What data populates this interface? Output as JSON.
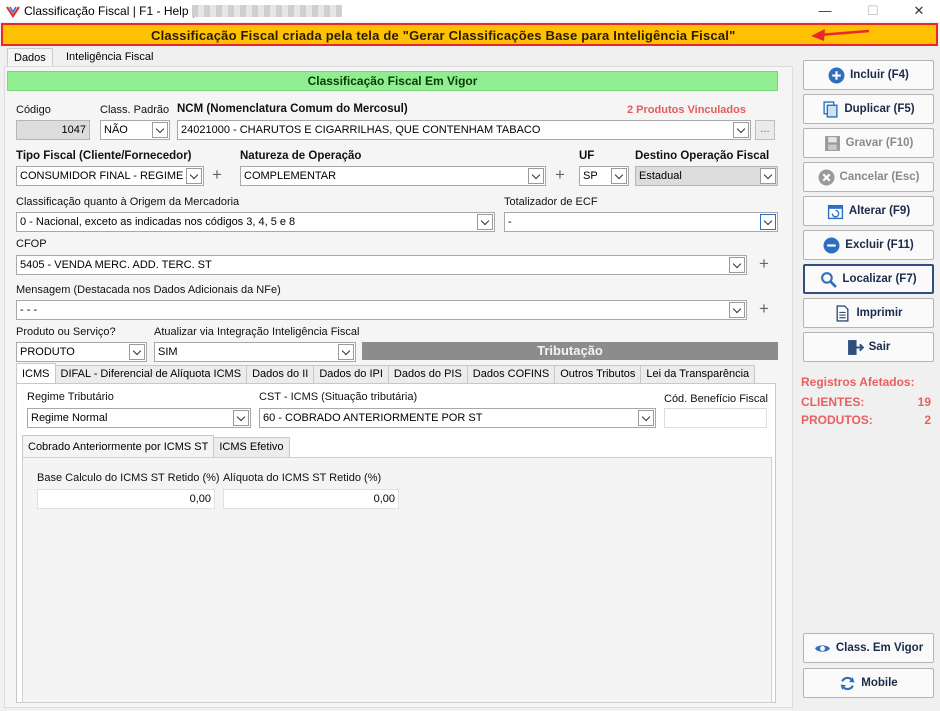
{
  "window": {
    "title": "Classificação Fiscal | F1 - Help |",
    "minimize": "—",
    "maximize": "☐",
    "close": "✕"
  },
  "banner": {
    "text": "Classificação Fiscal criada pela tela de \"Gerar Classificações Base para Inteligência Fiscal\""
  },
  "tabs": [
    "Dados",
    "Inteligência Fiscal"
  ],
  "section": {
    "title": "Classificação Fiscal Em Vigor"
  },
  "fields": {
    "codigo": {
      "label": "Código",
      "value": "1047"
    },
    "class_padrao": {
      "label": "Class. Padrão",
      "value": "NÃO"
    },
    "ncm": {
      "label": "NCM (Nomenclatura Comum do Mercosul)",
      "value": "24021000 - CHARUTOS E CIGARRILHAS, QUE CONTENHAM TABACO",
      "linked": "2 Produtos Vinculados",
      "ellipsis": "..."
    },
    "tipo_fiscal": {
      "label": "Tipo Fiscal (Cliente/Fornecedor)",
      "value": "CONSUMIDOR FINAL - REGIME N"
    },
    "natureza": {
      "label": "Natureza de Operação",
      "value": "COMPLEMENTAR"
    },
    "uf": {
      "label": "UF",
      "value": "SP"
    },
    "destino": {
      "label": "Destino Operação Fiscal",
      "value": "Estadual"
    },
    "origem": {
      "label": "Classificação quanto à Origem da Mercadoria",
      "value": "0 - Nacional, exceto as indicadas nos códigos 3, 4, 5 e 8"
    },
    "totalizador": {
      "label": "Totalizador de ECF",
      "value": "-"
    },
    "cfop": {
      "label": "CFOP",
      "value": "5405 - VENDA MERC. ADD. TERC. ST"
    },
    "mensagem": {
      "label": "Mensagem (Destacada nos Dados Adicionais da NFe)",
      "value": "- - -"
    },
    "produto_servico": {
      "label": "Produto ou Serviço?",
      "value": "PRODUTO"
    },
    "atualizar": {
      "label": "Atualizar via Integração Inteligência Fiscal",
      "value": "SIM"
    }
  },
  "plus": "+",
  "tributacao": {
    "title": "Tributação"
  },
  "subtabs": [
    "ICMS",
    "DIFAL - Diferencial de Alíquota ICMS",
    "Dados do II",
    "Dados do IPI",
    "Dados do PIS",
    "Dados COFINS",
    "Outros Tributos",
    "Lei da Transparência"
  ],
  "icms": {
    "regime": {
      "label": "Regime Tributário",
      "value": "Regime Normal"
    },
    "cst": {
      "label": "CST - ICMS (Situação tributária)",
      "value": "60 - COBRADO ANTERIORMENTE POR ST"
    },
    "beneficio": {
      "label": "Cód. Benefício Fiscal",
      "value": ""
    },
    "inner_tabs": [
      "Cobrado Anteriormente por ICMS ST",
      "ICMS Efetivo"
    ],
    "base_calculo": {
      "label": "Base Calculo do ICMS ST Retido (%)",
      "value": "0,00"
    },
    "aliquota": {
      "label": "Alíquota do ICMS ST Retido (%)",
      "value": "0,00"
    }
  },
  "buttons": {
    "incluir": "Incluir (F4)",
    "duplicar": "Duplicar (F5)",
    "gravar": "Gravar (F10)",
    "cancelar": "Cancelar (Esc)",
    "alterar": "Alterar (F9)",
    "excluir": "Excluir (F11)",
    "localizar": "Localizar (F7)",
    "imprimir": "Imprimir",
    "sair": "Sair",
    "class_vigor": "Class. Em Vigor",
    "mobile": "Mobile"
  },
  "stats": {
    "title": "Registros Afetados:",
    "clientes_label": "CLIENTES:",
    "clientes": "19",
    "produtos_label": "PRODUTOS:",
    "produtos": "2"
  },
  "colors": {
    "banner": "#ffc000",
    "banner_border": "#e8282d",
    "green": "#90ee90",
    "red": "#e85a5a",
    "blue": "#2f6fbf"
  }
}
